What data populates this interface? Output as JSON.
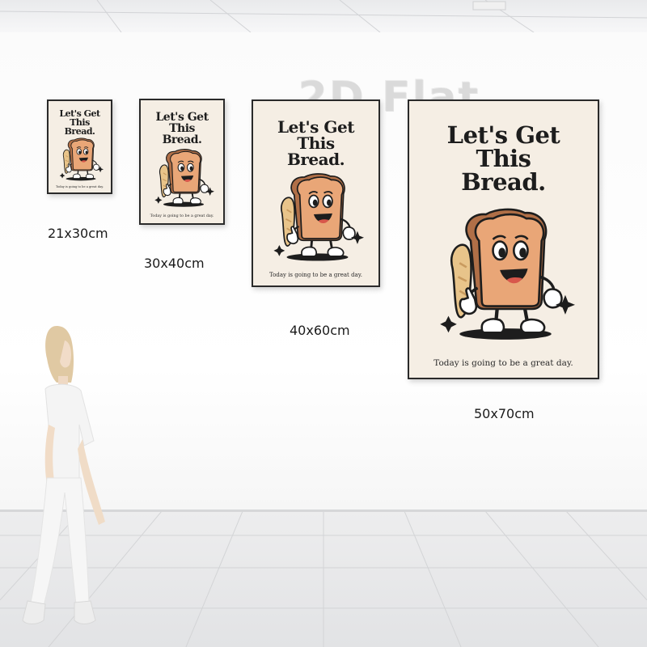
{
  "watermark": "2D Flat",
  "poster": {
    "title_lines": [
      "Let's Get",
      "This",
      "Bread."
    ],
    "tagline": "Today is going to be a great day."
  },
  "sizes": [
    "21x30cm",
    "30x40cm",
    "40x60cm",
    "50x70cm"
  ],
  "colors": {
    "paper": "#f5eee4",
    "bread": "#e9a677",
    "crust": "#b06f47",
    "baguette": "#e8c48a",
    "ink": "#1d1d1d"
  }
}
